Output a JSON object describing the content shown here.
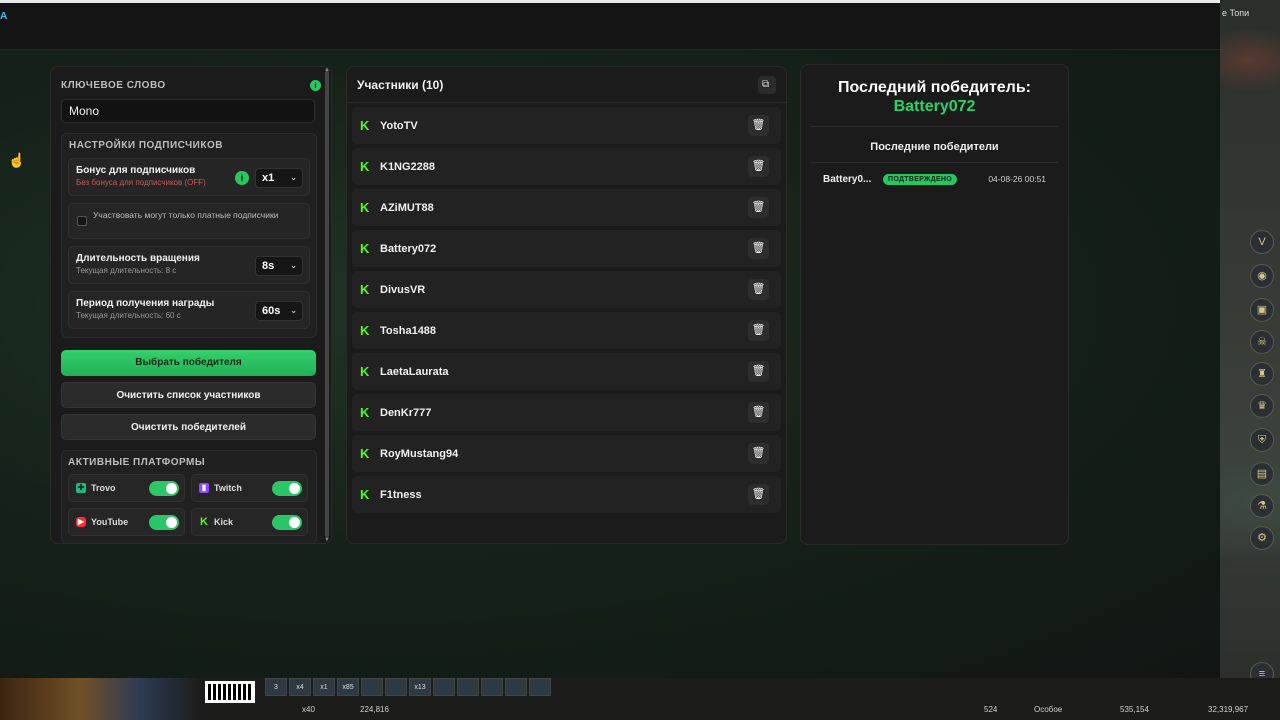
{
  "top": {
    "brand": "A"
  },
  "settings": {
    "keyword_label": "КЛЮЧЕВОЕ СЛОВО",
    "keyword_value": "Mono",
    "subscribers_section": "НАСТРОЙКИ ПОДПИСЧИКОВ",
    "bonus_title": "Бонус для подписчиков",
    "bonus_sub": "Без бонуса для подписчиков (OFF)",
    "bonus_value": "x1",
    "paid_only_label": "Участвовать могут только платные подписчики",
    "spin_title": "Длительность вращения",
    "spin_sub": "Текущая длительность: 8 с",
    "spin_value": "8s",
    "reward_title": "Период получения награды",
    "reward_sub": "Текущая длительность: 60 с",
    "reward_value": "60s",
    "info_glyph": "i"
  },
  "buttons": {
    "pick_winner": "Выбрать победителя",
    "clear_participants": "Очистить список участников",
    "clear_winners": "Очистить победителей"
  },
  "platforms": {
    "title": "АКТИВНЫЕ ПЛАТФОРМЫ",
    "items": [
      {
        "name": "Trovo",
        "icon": "trovo-icon",
        "enabled": true
      },
      {
        "name": "Twitch",
        "icon": "twitch-icon",
        "enabled": true
      },
      {
        "name": "YouTube",
        "icon": "youtube-icon",
        "enabled": true
      },
      {
        "name": "Kick",
        "icon": "kick-icon",
        "enabled": true
      }
    ]
  },
  "participants": {
    "title": "Участники (10)",
    "list": [
      "YotoTV",
      "K1NG2288",
      "AZiMUT88",
      "Battery072",
      "DivusVR",
      "Tosha1488",
      "LaetaLaurata",
      "DenKr777",
      "RoyMustang94",
      "F1tness"
    ]
  },
  "winner": {
    "last_title": "Последний победитель:",
    "last_name": "Battery072",
    "recent_title": "Последние победители",
    "recent": [
      {
        "name": "Battery0...",
        "status": "ПОДТВЕРЖДЕНО",
        "time": "04-08-26 00:51"
      }
    ]
  },
  "game_hud": {
    "location": "е Топи",
    "slot_labels": [
      "3",
      "x4",
      "x1",
      "x85",
      "",
      "",
      "x13",
      "",
      "",
      "",
      "",
      ""
    ],
    "value_1": "x40",
    "value_2": "224,816",
    "value_3": "524",
    "mode": "Особое",
    "value_4": "535,154",
    "value_5": "32,319,967"
  },
  "colors": {
    "accent": "#27c760",
    "kick": "#53fc18",
    "bg": "#1b1b1b"
  }
}
